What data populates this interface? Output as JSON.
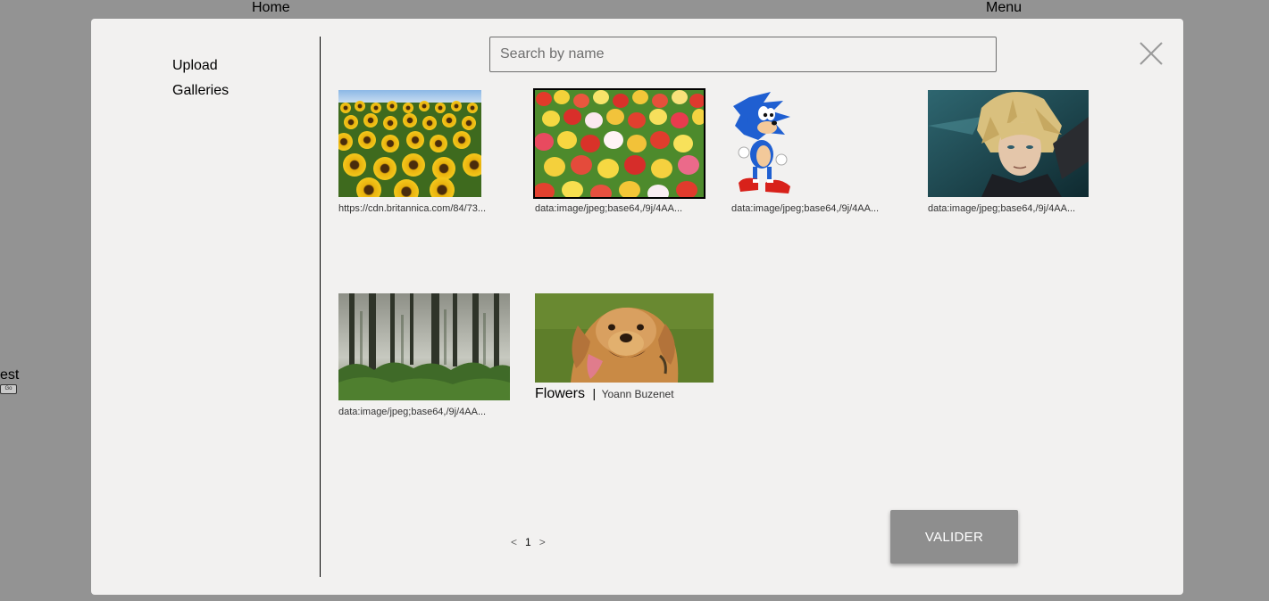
{
  "background": {
    "nav_home": "Home",
    "nav_menu": "Menu",
    "side_text": "est",
    "go_button": "Go"
  },
  "modal": {
    "sidebar": {
      "items": [
        {
          "label": "Upload"
        },
        {
          "label": "Galleries"
        }
      ]
    },
    "search": {
      "placeholder": "Search by name",
      "value": ""
    },
    "close_icon": "close-icon",
    "images": [
      {
        "kind": "sunflowers",
        "caption": "https://cdn.britannica.com/84/73...",
        "selected": false
      },
      {
        "kind": "tulips",
        "caption": "data:image/jpeg;base64,/9j/4AA...",
        "selected": true
      },
      {
        "kind": "sonic",
        "caption": "data:image/jpeg;base64,/9j/4AA...",
        "selected": false
      },
      {
        "kind": "character",
        "caption": "data:image/jpeg;base64,/9j/4AA...",
        "selected": false
      },
      {
        "kind": "forest",
        "caption": "data:image/jpeg;base64,/9j/4AA...",
        "selected": false
      },
      {
        "kind": "dog",
        "title": "Flowers",
        "separator": "|",
        "author": "Yoann Buzenet",
        "selected": false
      }
    ],
    "pagination": {
      "prev": "<",
      "current": "1",
      "next": ">"
    },
    "submit_label": "VALIDER",
    "colors": {
      "modal_bg": "#f2f1f0",
      "overlay": "#939393",
      "button": "#8e8e8e"
    }
  }
}
